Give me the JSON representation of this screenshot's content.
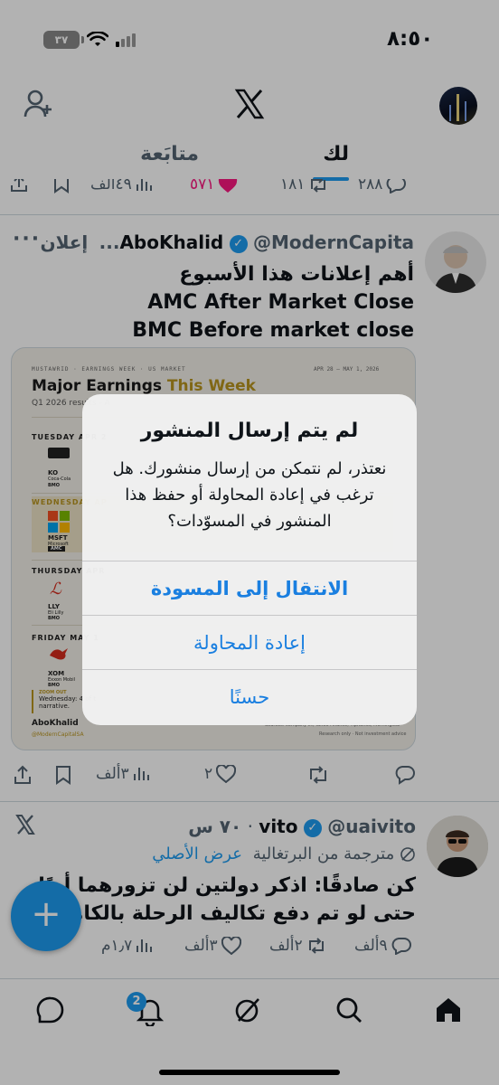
{
  "status": {
    "time": "٨:٥٠",
    "battery": "٣٧"
  },
  "tabs": {
    "for_you": "لك",
    "following": "متابَعة"
  },
  "prev_tweet": {
    "actions": {
      "replies": "٢٨٨",
      "reposts": "١٨١",
      "likes": "٥٧١",
      "views": "٤٩ألف"
    }
  },
  "tweet1": {
    "name": "AboKhalid",
    "handle": "@ModernCapita...",
    "ad_label": "إعلان",
    "lines": [
      "أهم إعلانات هذا الأسبوع",
      "AMC After Market Close",
      "BMC Before market close"
    ],
    "media": {
      "top_bar": "MUSTAWRID · EARNINGS WEEK · US MARKET",
      "date_range": "APR 28 – MAY 1, 2026",
      "title_a": "Major Earnings ",
      "title_b": "This Week",
      "subtitle": "Q1 2026 results - A",
      "days": [
        {
          "day": "TUESDAY APR 2",
          "ticker": "KO",
          "company": "Coca-Cola",
          "tag": "BMO"
        },
        {
          "day": "WEDNESDAY AP",
          "ticker": "MSFT",
          "company": "Microsoft",
          "tag": "AMC"
        },
        {
          "day": "THURSDAY APR",
          "ticker": "LLY",
          "company": "Eli Lilly",
          "tag": "BMO"
        },
        {
          "day": "FRIDAY MAY 1",
          "ticker": "XOM",
          "company": "Exxon Mobil",
          "tag": "BMO"
        }
      ],
      "zoom_label": "ZOOM OUT",
      "zoom_text": "Wednesday: 4 of t",
      "zoom_text2": "narrative.",
      "sign_name": "AboKhalid",
      "sign_handle": "@ModernCapitalSA",
      "sources": "Sources: company IR, Yahoo Finance, TipRanks, Morningstar",
      "research": "Research only · Not investment advice"
    },
    "actions": {
      "likes": "٢",
      "views": "٣ألف"
    }
  },
  "tweet2": {
    "name": "vito",
    "handle": "@uaivito",
    "time": "٧٠ س",
    "translated": "مترجمة من البرتغالية",
    "show_original": "عرض الأصلي",
    "text": "كن صادقًا: اذكر دولتين لن تزورهما أبدًا حتى لو تم دفع تكاليف الرحلة بالكامل.",
    "actions": {
      "replies": "٩ألف",
      "reposts": "٢ألف",
      "likes": "٣ألف",
      "views": "١٫٧م"
    }
  },
  "dialog": {
    "title": "لم يتم إرسال المنشور",
    "message": "نعتذر، لم نتمكن من إرسال منشورك. هل ترغب في إعادة المحاولة أو حفظ هذا المنشور في المسوّدات؟",
    "btn_draft": "الانتقال إلى المسودة",
    "btn_retry": "إعادة المحاولة",
    "btn_ok": "حسنًا"
  },
  "nav": {
    "notif_count": "2"
  },
  "icons": [
    "add-user-icon",
    "x-logo-icon",
    "share-icon",
    "bookmark-icon",
    "views-icon",
    "like-icon",
    "repost-icon",
    "reply-icon",
    "grok-icon",
    "compose-icon",
    "messages-icon",
    "bell-icon",
    "search-icon",
    "home-icon"
  ],
  "colors": {
    "accent": "#1d9bf0",
    "like_pink": "#f91880",
    "dialog_button": "#1a7fe0"
  }
}
